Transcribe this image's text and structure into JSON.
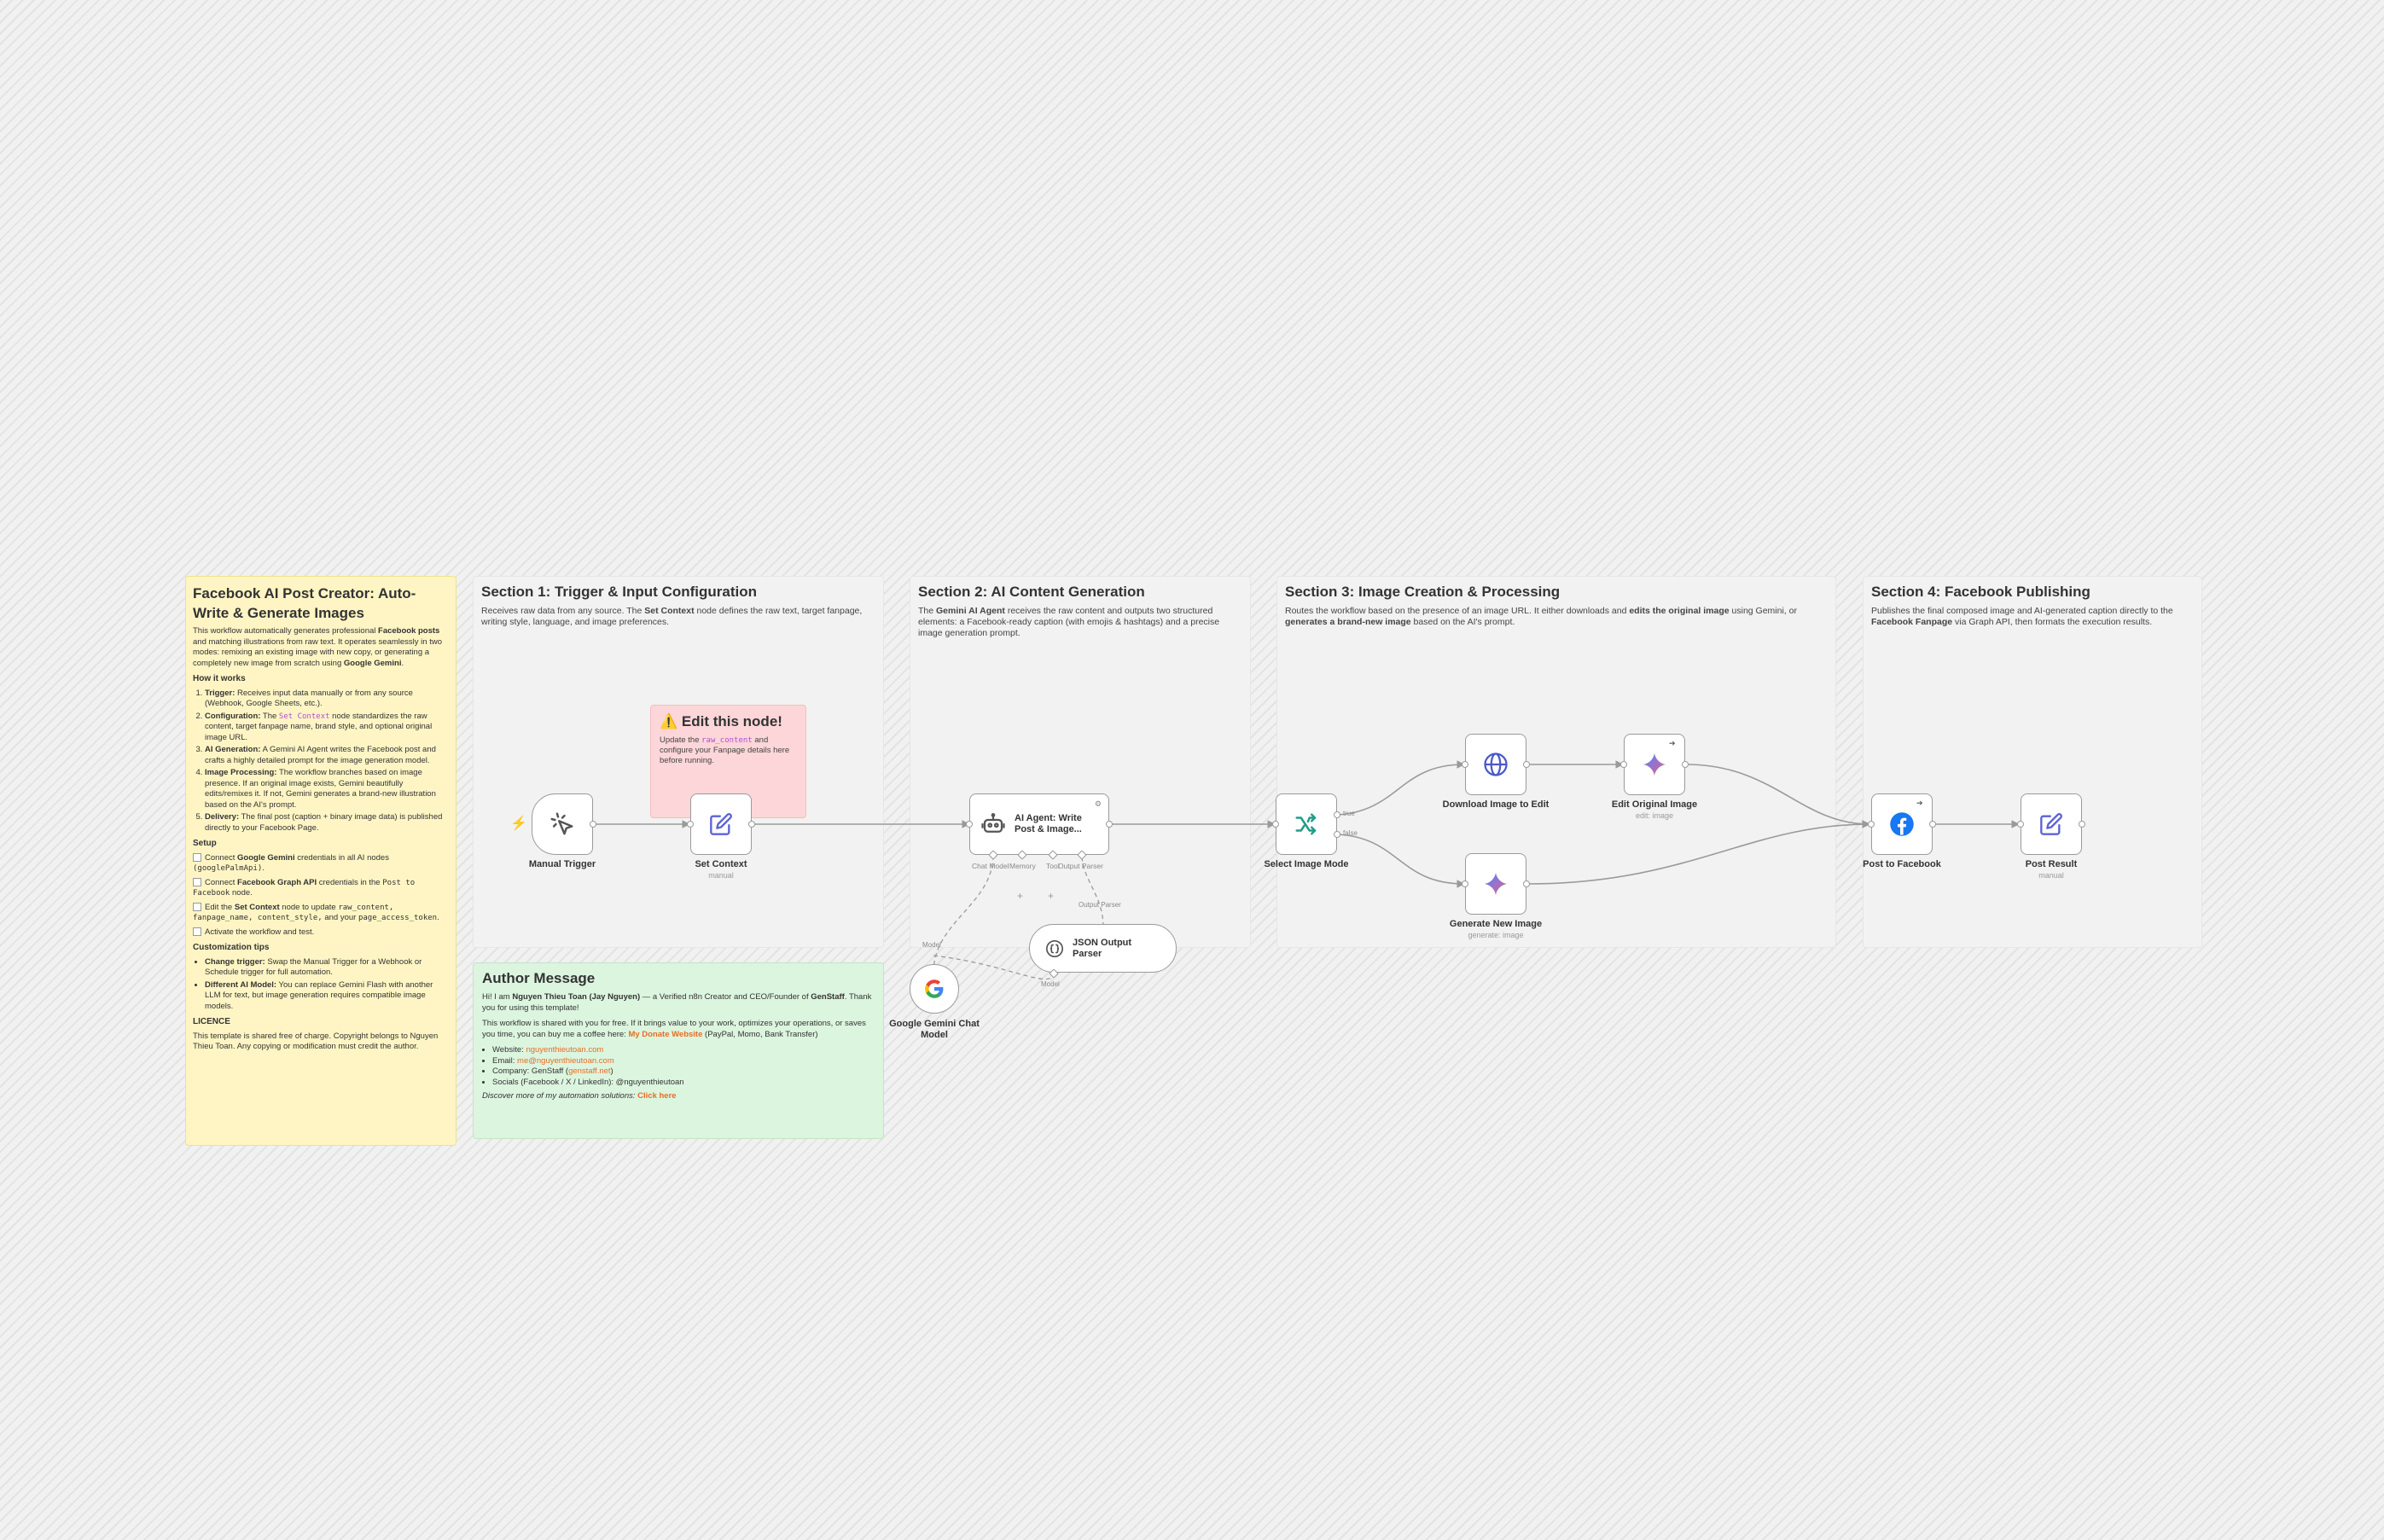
{
  "colors": {
    "canvas_bg": "#f1f1f1",
    "sticky_yellow": "#fff5c4",
    "sticky_gray": "#f2f2f2",
    "sticky_pink": "#fcd6d8",
    "sticky_green": "#dcf5df",
    "edge": "#9a9a9a",
    "link_orange": "#e96c24",
    "trigger_icon": "#f28c38"
  },
  "intro_note": {
    "title": "Facebook AI Post Creator: Auto-Write & Generate Images",
    "intro_a": "This workflow automatically generates professional ",
    "intro_b": "Facebook posts",
    "intro_c": " and matching illustrations from raw text. It operates seamlessly in two modes: remixing an existing image with new copy, or generating a completely new image from scratch using ",
    "intro_d": "Google Gemini",
    "intro_e": ".",
    "how_heading": "How it works",
    "how_items": [
      {
        "bold": "Trigger:",
        "text": " Receives input data manually or from any source (Webhook, Google Sheets, etc.)."
      },
      {
        "bold": "Configuration:",
        "pre": " The ",
        "code": "Set Context",
        "text": " node standardizes the raw content, target fanpage name, brand style, and optional original image URL."
      },
      {
        "bold": "AI Generation:",
        "text": " A Gemini AI Agent writes the Facebook post and crafts a highly detailed prompt for the image generation model."
      },
      {
        "bold": "Image Processing:",
        "text": " The workflow branches based on image presence. If an original image exists, Gemini beautifully edits/remixes it. If not, Gemini generates a brand-new illustration based on the AI's prompt."
      },
      {
        "bold": "Delivery:",
        "text": " The final post (caption + binary image data) is published directly to your Facebook Page."
      }
    ],
    "setup_heading": "Setup",
    "setup_1a": "Connect ",
    "setup_1b": "Google Gemini",
    "setup_1c": " credentials in all AI nodes ",
    "setup_1d": "(googlePalmApi)",
    "setup_1e": ".",
    "setup_2a": "Connect ",
    "setup_2b": "Facebook Graph API",
    "setup_2c": " credentials in the ",
    "setup_2d": "Post to Facebook",
    "setup_2e": " node.",
    "setup_3a": "Edit the ",
    "setup_3b": "Set Context",
    "setup_3c": " node to update ",
    "setup_3d": "raw_content, fanpage_name, content_style,",
    "setup_3e": " and your ",
    "setup_3f": "page_access_token",
    "setup_3g": ".",
    "setup_4": "Activate the workflow and test.",
    "custom_heading": "Customization tips",
    "custom_1a": "Change trigger:",
    "custom_1b": " Swap the Manual Trigger for a Webhook or Schedule trigger for full automation.",
    "custom_2a": "Different AI Model:",
    "custom_2b": " You can replace Gemini Flash with another LLM for text, but image generation requires compatible image models.",
    "licence_heading": "LICENCE",
    "licence_text": "This template is shared free of charge. Copyright belongs to Nguyen Thieu Toan. Any copying or modification must credit the author."
  },
  "section1": {
    "title": "Section 1: Trigger & Input Configuration",
    "desc_a": "Receives raw data from any source. The ",
    "desc_b": "Set Context",
    "desc_c": " node defines the raw text, target fanpage, writing style, language, and image preferences."
  },
  "section2": {
    "title": "Section 2: AI Content Generation",
    "desc_a": "The ",
    "desc_b": "Gemini AI Agent",
    "desc_c": " receives the raw content and outputs two structured elements: a Facebook-ready caption (with emojis & hashtags) and a precise image generation prompt."
  },
  "section3": {
    "title": "Section 3: Image Creation & Processing",
    "desc_a": "Routes the workflow based on the presence of an image URL. It either downloads and ",
    "desc_b": "edits the original image",
    "desc_c": " using Gemini, or ",
    "desc_d": "generates a brand-new image",
    "desc_e": " based on the AI's prompt."
  },
  "section4": {
    "title": "Section 4: Facebook Publishing",
    "desc_a": "Publishes the final composed image and AI-generated caption directly to the ",
    "desc_b": "Facebook Fanpage",
    "desc_c": " via Graph API, then formats the execution results."
  },
  "edit_note": {
    "title": "⚠️ Edit this node!",
    "text_a": "Update the ",
    "code": "raw_content",
    "text_b": " and configure your Fanpage details here before running."
  },
  "author_note": {
    "title": "Author Message",
    "p1_a": "Hi! I am ",
    "p1_b": "Nguyen Thieu Toan (Jay Nguyen)",
    "p1_c": " — a Verified n8n Creator and CEO/Founder of ",
    "p1_d": "GenStaff",
    "p1_e": ". Thank you for using this template!",
    "p2_a": "This workflow is shared with you for free. If it brings value to your work, optimizes your operations, or saves you time, you can buy me a coffee here: ",
    "p2_b": "My Donate Website",
    "p2_c": " (PayPal, Momo, Bank Transfer)",
    "website_label": "Website: ",
    "website": "nguyenthieutoan.com",
    "email_label": "Email: ",
    "email": "me@nguyenthieutoan.com",
    "company_label": "Company: GenStaff (",
    "company_link": "genstaff.net",
    "company_end": ")",
    "socials": "Socials (Facebook / X / LinkedIn): @nguyenthieutoan",
    "discover_a": "Discover more of my automation solutions: ",
    "discover_b": "Click here"
  },
  "nodes": {
    "manual_trigger": {
      "label": "Manual Trigger"
    },
    "set_context": {
      "label": "Set Context",
      "sub": "manual"
    },
    "ai_agent": {
      "label": "AI Agent: Write Post & Image...",
      "ports": [
        "Chat Model",
        "Memory",
        "Tool",
        "Output Parser"
      ]
    },
    "gemini_chat": {
      "label": "Google Gemini Chat Model",
      "port_label": "Model"
    },
    "json_parser": {
      "label": "JSON Output Parser",
      "top_label": "Output Parser",
      "model_label": "Model"
    },
    "select_mode": {
      "label": "Select Image Mode",
      "branch_true": "true",
      "branch_false": "false"
    },
    "download_image": {
      "label": "Download Image to Edit"
    },
    "edit_original": {
      "label": "Edit Original Image",
      "sub": "edit: image"
    },
    "generate_new": {
      "label": "Generate New Image",
      "sub": "generate: image"
    },
    "post_facebook": {
      "label": "Post to Facebook"
    },
    "post_result": {
      "label": "Post Result",
      "sub": "manual"
    }
  },
  "icons": [
    "cursor-click-icon",
    "pencil-edit-icon",
    "robot-icon",
    "google-g-icon",
    "braces-icon",
    "split-branch-icon",
    "globe-icon",
    "gemini-sparkle-icon",
    "facebook-icon",
    "lightning-icon"
  ]
}
